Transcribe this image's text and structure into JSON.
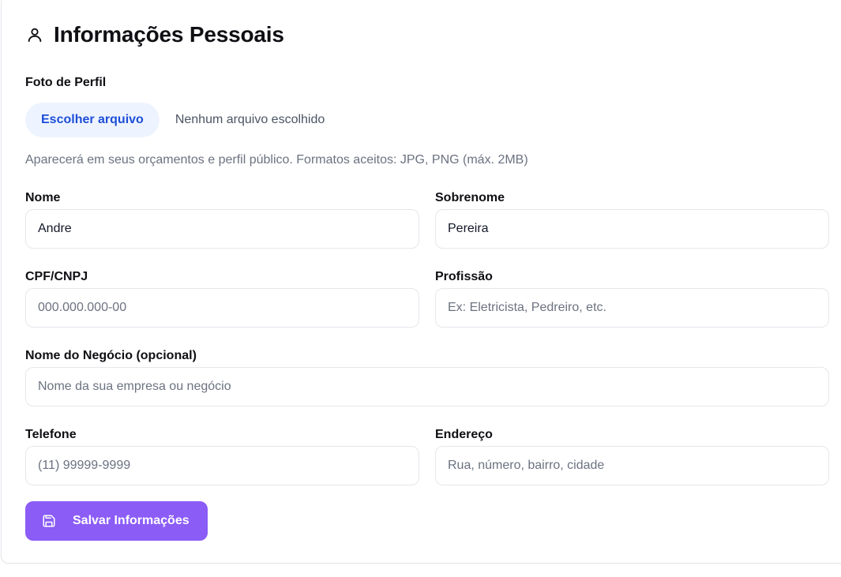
{
  "header": {
    "title": "Informações Pessoais",
    "icon": "user-icon"
  },
  "profile_photo": {
    "label": "Foto de Perfil",
    "button_label": "Escolher arquivo",
    "file_status": "Nenhum arquivo escolhido",
    "help_text": "Aparecerá em seus orçamentos e perfil público. Formatos aceitos: JPG, PNG (máx. 2MB)"
  },
  "fields": {
    "first_name": {
      "label": "Nome",
      "value": "Andre",
      "placeholder": ""
    },
    "last_name": {
      "label": "Sobrenome",
      "value": "Pereira",
      "placeholder": ""
    },
    "document": {
      "label": "CPF/CNPJ",
      "value": "",
      "placeholder": "000.000.000-00"
    },
    "profession": {
      "label": "Profissão",
      "value": "",
      "placeholder": "Ex: Eletricista, Pedreiro, etc."
    },
    "business_name": {
      "label": "Nome do Negócio (opcional)",
      "value": "",
      "placeholder": "Nome da sua empresa ou negócio"
    },
    "phone": {
      "label": "Telefone",
      "value": "",
      "placeholder": "(11) 99999-9999"
    },
    "address": {
      "label": "Endereço",
      "value": "",
      "placeholder": "Rua, número, bairro, cidade"
    }
  },
  "save_button": {
    "label": "Salvar Informações",
    "icon": "save-icon"
  },
  "colors": {
    "accent": "#8b5cf6",
    "file_button_bg": "#eef4ff",
    "file_button_text": "#1d4ed8",
    "border": "#e5e7eb"
  }
}
